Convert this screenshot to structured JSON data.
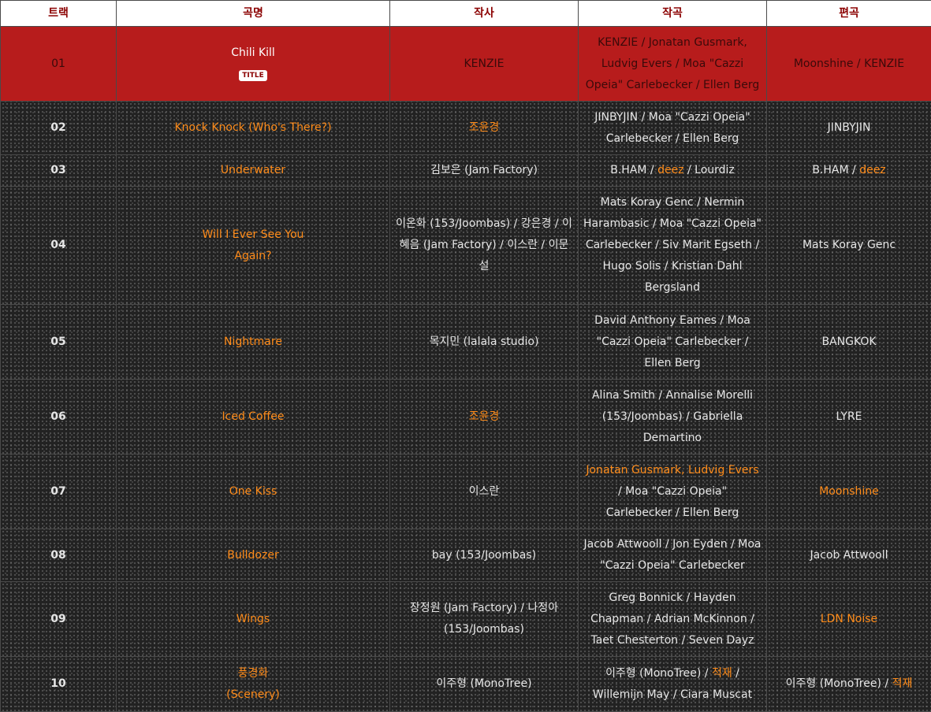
{
  "headers": {
    "track": "트랙",
    "song": "곡명",
    "lyrics": "작사",
    "composition": "작곡",
    "arrangement": "편곡"
  },
  "tracks": [
    {
      "num": "01",
      "title": "Chili Kill",
      "badge": "TITLE",
      "lyrics": "KENZIE",
      "composition": "KENZIE / Jonatan Gusmark, Ludvig Evers / Moa \"Cazzi Opeia\" Carlebecker / Ellen Berg",
      "arrangement": "Moonshine / KENZIE"
    },
    {
      "num": "02",
      "title": "Knock Knock (Who's There?)",
      "lyrics": "조윤경",
      "composition": "JINBYJIN / Moa \"Cazzi Opeia\" Carlebecker / Ellen Berg",
      "arrangement": "JINBYJIN"
    },
    {
      "num": "03",
      "title": "Underwater",
      "lyrics": "김보은 (Jam Factory)",
      "composition_a": "B.HAM / ",
      "composition_b": "deez",
      "composition_c": " / Lourdiz",
      "arrangement_a": "B.HAM / ",
      "arrangement_b": "deez"
    },
    {
      "num": "04",
      "title": "Will I Ever See You Again?",
      "lyrics": "이온화 (153/Joombas) / 강은경 / 이혜음 (Jam Factory) / 이스란 / 이문설",
      "composition": "Mats Koray Genc / Nermin Harambasic / Moa \"Cazzi Opeia\" Carlebecker / Siv Marit Egseth / Hugo Solis / Kristian Dahl Bergsland",
      "arrangement": "Mats Koray Genc"
    },
    {
      "num": "05",
      "title": "Nightmare",
      "lyrics": "목지민 (lalala studio)",
      "composition": "David Anthony Eames / Moa \"Cazzi Opeia\" Carlebecker / Ellen Berg",
      "arrangement": "BANGKOK"
    },
    {
      "num": "06",
      "title": "Iced Coffee",
      "lyrics": "조윤경",
      "composition": "Alina Smith / Annalise Morelli (153/Joombas) / Gabriella Demartino",
      "arrangement": "LYRE"
    },
    {
      "num": "07",
      "title": "One Kiss",
      "lyrics": "이스란",
      "composition_a": "Jonatan Gusmark, Ludvig Evers",
      "composition_b": " / Moa \"Cazzi Opeia\" Carlebecker / Ellen Berg",
      "arrangement": "Moonshine"
    },
    {
      "num": "08",
      "title": "Bulldozer",
      "lyrics": "bay (153/Joombas)",
      "composition": "Jacob Attwooll / Jon Eyden / Moa \"Cazzi Opeia\" Carlebecker",
      "arrangement": "Jacob Attwooll"
    },
    {
      "num": "09",
      "title": "Wings",
      "lyrics": "장정원 (Jam Factory) / 나정아 (153/Joombas)",
      "composition": "Greg Bonnick / Hayden Chapman / Adrian McKinnon / Taet Chesterton / Seven Dayz",
      "arrangement": "LDN Noise"
    },
    {
      "num": "10",
      "title": "풍경화 (Scenery)",
      "lyrics": "이주형 (MonoTree)",
      "composition_a": "이주형 (MonoTree) / ",
      "composition_b": "적재",
      "composition_c": " / Willemijn May / Ciara Muscat",
      "arrangement_a": "이주형 (MonoTree) / ",
      "arrangement_b": "적재"
    }
  ],
  "colors": {
    "header_bg": "#ffffff",
    "header_text": "#8b0000",
    "title_row_bg": "#b71c1c",
    "link_orange": "#ff8c1a",
    "body_bg": "#222222"
  }
}
